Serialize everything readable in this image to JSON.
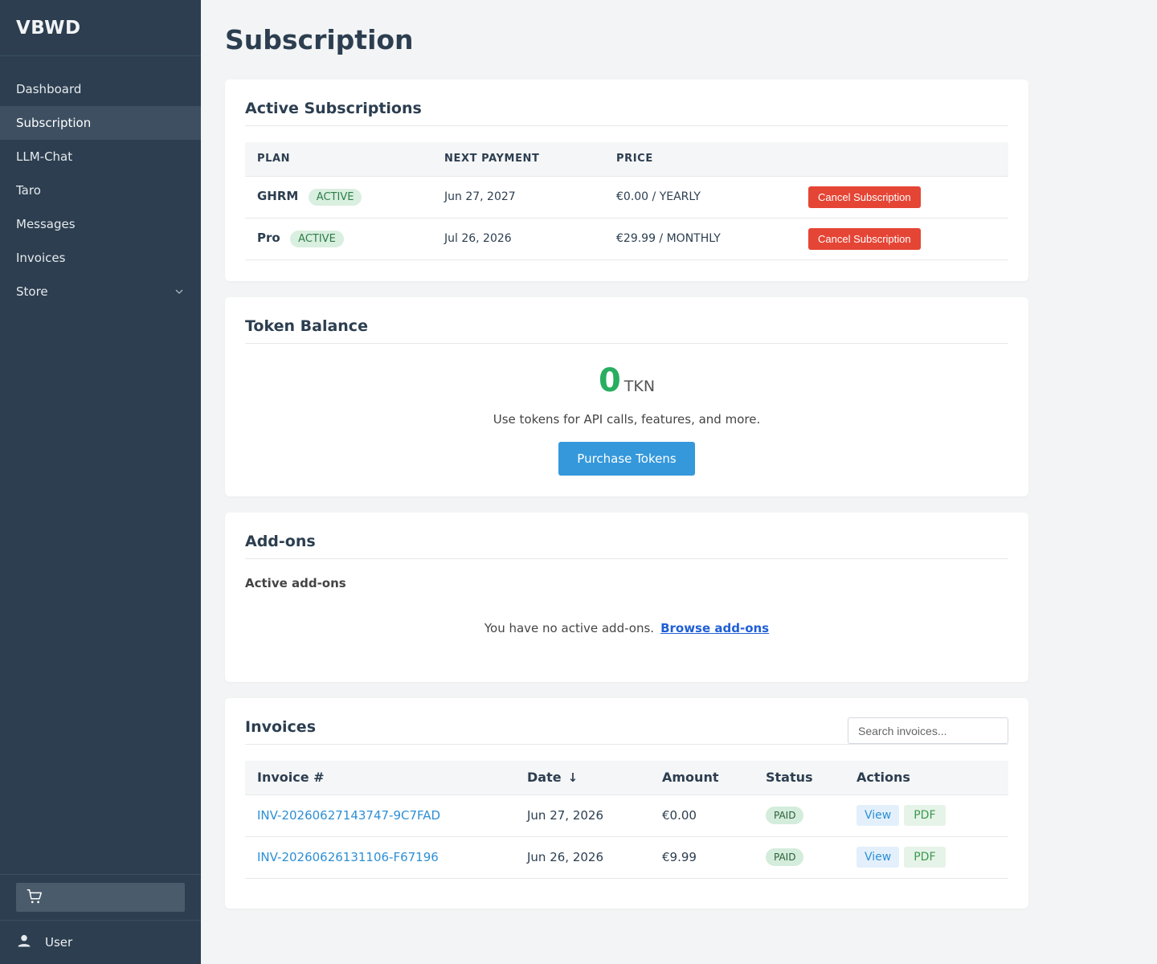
{
  "sidebar": {
    "brand": "VBWD",
    "items": [
      {
        "label": "Dashboard"
      },
      {
        "label": "Subscription"
      },
      {
        "label": "LLM-Chat"
      },
      {
        "label": "Taro"
      },
      {
        "label": "Messages"
      },
      {
        "label": "Invoices"
      },
      {
        "label": "Store"
      }
    ],
    "user_label": "User"
  },
  "page_title": "Subscription",
  "subscriptions": {
    "title": "Active Subscriptions",
    "columns": [
      "PLAN",
      "NEXT PAYMENT",
      "PRICE"
    ],
    "rows": [
      {
        "plan": "GHRM",
        "status": "ACTIVE",
        "next_payment": "Jun 27, 2027",
        "price": "€0.00 / YEARLY",
        "action": "Cancel Subscription"
      },
      {
        "plan": "Pro",
        "status": "ACTIVE",
        "next_payment": "Jul 26, 2026",
        "price": "€29.99 / MONTHLY",
        "action": "Cancel Subscription"
      }
    ]
  },
  "tokens": {
    "title": "Token Balance",
    "amount": "0",
    "unit": "TKN",
    "description": "Use tokens for API calls, features, and more.",
    "purchase_label": "Purchase Tokens"
  },
  "addons": {
    "title": "Add-ons",
    "subtitle": "Active add-ons",
    "empty_text": "You have no active add-ons.",
    "browse_label": "Browse add-ons"
  },
  "invoices": {
    "title": "Invoices",
    "search_placeholder": "Search invoices...",
    "columns": [
      "Invoice #",
      "Date",
      "Amount",
      "Status",
      "Actions"
    ],
    "sort_indicator": "↓",
    "rows": [
      {
        "number": "INV-20260627143747-9C7FAD",
        "date": "Jun 27, 2026",
        "amount": "€0.00",
        "status": "PAID",
        "view": "View",
        "pdf": "PDF"
      },
      {
        "number": "INV-20260626131106-F67196",
        "date": "Jun 26, 2026",
        "amount": "€9.99",
        "status": "PAID",
        "view": "View",
        "pdf": "PDF"
      }
    ]
  },
  "colors": {
    "sidebar_bg": "#2c3e50",
    "accent_blue": "#3498db",
    "danger_red": "#e54535",
    "token_green": "#27ae60"
  }
}
